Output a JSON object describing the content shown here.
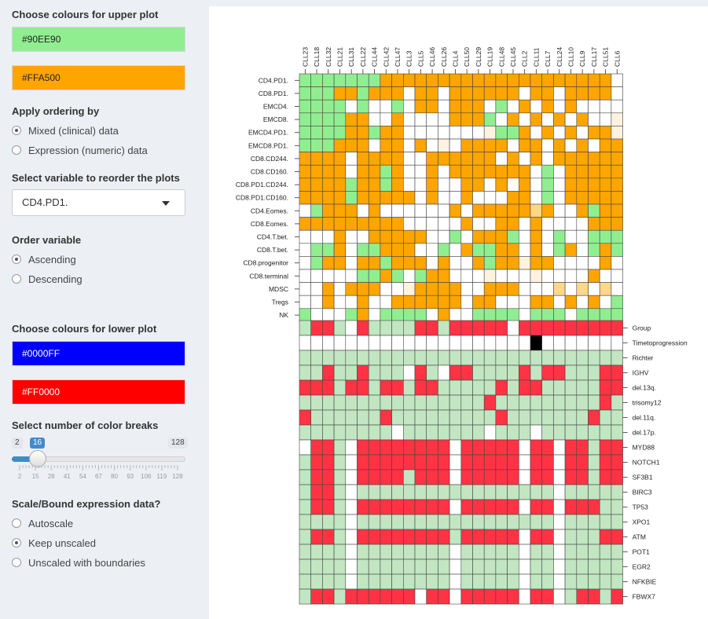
{
  "upper": {
    "title": "Choose colours for upper plot",
    "color1": "#90EE90",
    "color2": "#FFA500"
  },
  "ordering": {
    "title": "Apply ordering by",
    "options": [
      "Mixed (clinical) data",
      "Expression (numeric) data"
    ],
    "selected": 0
  },
  "reorder": {
    "title": "Select variable to reorder the plots",
    "value": "CD4.PD1."
  },
  "order_variable": {
    "title": "Order variable",
    "options": [
      "Ascending",
      "Descending"
    ],
    "selected": 0
  },
  "lower": {
    "title": "Choose colours for lower plot",
    "color1": "#0000FF",
    "color2": "#FF0000"
  },
  "breaks": {
    "title": "Select number of color breaks",
    "min": "2",
    "max": "128",
    "value": "16",
    "ticks": [
      "2",
      "15",
      "28",
      "41",
      "54",
      "67",
      "80",
      "93",
      "106",
      "119",
      "128"
    ]
  },
  "scale": {
    "title": "Scale/Bound expression data?",
    "options": [
      "Autoscale",
      "Keep unscaled",
      "Unscaled with boundaries"
    ],
    "selected": 1
  },
  "chart_data": {
    "type": "heatmap",
    "columns": [
      "CLL23",
      "CLL18",
      "CLL32",
      "CLL21",
      "CLL31",
      "CLL22",
      "CLL44",
      "CLL42",
      "CLL47",
      "CLL3",
      "CLL5",
      "CLL46",
      "CLL26",
      "CLL4",
      "CLL50",
      "CLL29",
      "CLL19",
      "CLL48",
      "CLL45",
      "CLL2",
      "CLL11",
      "CLL7",
      "CLL24",
      "CLL10",
      "CLL9",
      "CLL17",
      "CLL51",
      "CLL6"
    ],
    "upper_rows": [
      "CD4.PD1.",
      "CD8.PD1.",
      "EMCD4.",
      "EMCD8.",
      "EMCD4.PD1.",
      "EMCD8.PD1.",
      "CD8.CD244.",
      "CD8.CD160.",
      "CD8.PD1.CD244.",
      "CD8.PD1.CD160.",
      "CD4.Eomes.",
      "CD8.Eomes.",
      "CD4.T.bet.",
      "CD8.T.bet.",
      "CD8.progenitor",
      "CD8.terminal",
      "MDSC",
      "Tregs",
      "NK"
    ],
    "upper_colors": {
      "g": "#90EE90",
      "o": "#FFA500",
      "w": "#FFFFFF",
      "l": "#FFD68A",
      "p": "#FFF3E0"
    },
    "upper_matrix": [
      "gggggggoooooooooooooooooooow",
      "gggoogooowoowoooooowoowoooow",
      "ggggwgwwgwoowooowgwowowowwww",
      "ggggoowwowwwwooogwowowowowwp",
      "ggggoogoowwwwwwwpggowowowoop",
      "gggooowoowowpwoooowoowowowoo",
      "oooowoooowwoooooowowowoooooo",
      "oooowoogowwowooooooowgwooooo",
      "oooogoogowwowwoowowowgwooooo",
      "oooogooooowowwowwwoowgwooooo",
      "wgooowowwwwwwowooooolowwogoo",
      "ooooooooowwwwwowwoowowwwwooo",
      "wwwowwooooowwgwooogwowgwwggg",
      "wggowggooowwgwoggoowowgowgog",
      "wgoowoogooowowwogoopoowwwwow",
      "wwwwwggogwgoowwwpwwwpwwwwoww",
      "wwowooowwpoooowwooowwwlwlwlw",
      "wwowwowwoooooowoowwwoowowowg",
      "gwwwgowggggwowwggggwgggwgggg"
    ],
    "lower_rows": [
      "Group",
      "Timetoprogression",
      "Richter",
      "IGHV",
      "del.13q.",
      "trisomy12",
      "del.11q.",
      "del.17p.",
      "MYD88",
      "NOTCH1",
      "SF3B1",
      "BIRC3",
      "TP53",
      "XPO1",
      "ATM",
      "POT1",
      "EGR2",
      "NFKBIE",
      "FBWX7"
    ],
    "lower_colors": {
      "r": "#FF3344",
      "g": "#C1E6C1",
      "w": "#FFFFFF",
      "k": "#000000"
    },
    "lower_matrix": [
      "grrgwrggggrrgrrrrrwrrrrrrrrr",
      "wwwwwwwwwwwwwwwwwwwwkwwwwwww",
      "gggggggggggggggggggggggggggg",
      "ggrggrgggwrgwrrggggrgrrgggrr",
      "rrrgrrgrrgrrgggggrgrrgggggrr",
      "ggggggggggggggggrgggggggggrg",
      "rggggggrgggggggggrgggggggrgg",
      "ggggggggwgggggggwgggwggggggg"
    ],
    "lower_matrix_2": [
      "wrrgwrrrrrrrrwrrrrrwrrwrrgrr",
      "grrgwrrrrrrrrwrrrrrwrrwrrgrr",
      "grrgwrrrrgrrrwrrrrrwrrwrrgrr",
      "grrgwgggggggggggggggggwggggg",
      "grrgwrrrrrrrrwrrrrrwrrwrrrgg",
      "ggggwgggggggggggggggggwggggg",
      "grrgwrrrrrrrrgrrrrrwrrwgggrr",
      "ggggwggggggggwgggggwggwggggg",
      "ggggwggggggggwgggggwggwggggg",
      "ggggwggggggggwgggggwggwggggg",
      "grrgrrrrrrwrrwrrrrrwrrwgrrgr"
    ]
  }
}
